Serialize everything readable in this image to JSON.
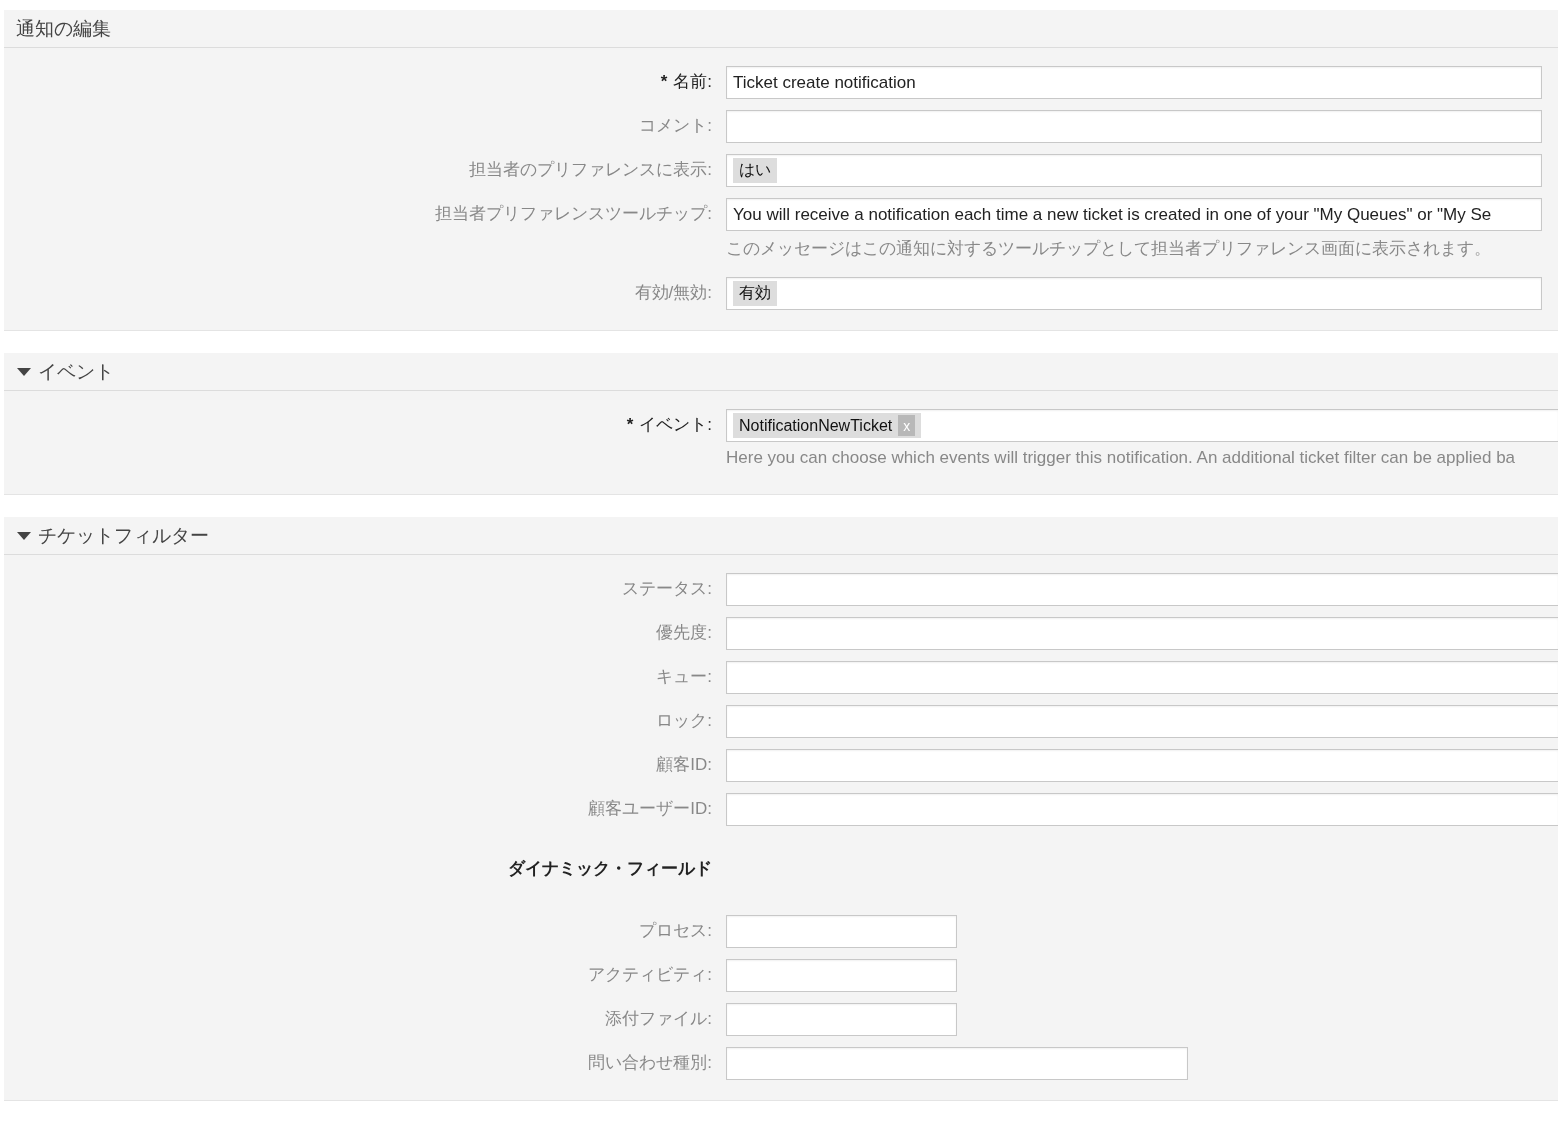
{
  "required_mark": "*",
  "sections": [
    {
      "title": "通知の編集",
      "fields": [
        {
          "kind": "text",
          "label": "名前:",
          "required": true,
          "value": "Ticket create notification"
        },
        {
          "kind": "text",
          "label": "コメント:",
          "required": false
        },
        {
          "kind": "select",
          "label": "担当者のプリファレンスに表示:",
          "required": false,
          "tags": [
            "はい"
          ]
        },
        {
          "kind": "text",
          "label": "担当者プリファレンスツールチップ:",
          "required": false,
          "value": "You will receive a notification each time a new ticket is created in one of your \"My Queues\" or \"My Se",
          "help": "このメッセージはこの通知に対するツールチップとして担当者プリファレンス画面に表示されます。"
        },
        {
          "kind": "select",
          "label": "有効/無効:",
          "required": false,
          "tags": [
            "有効"
          ]
        }
      ]
    },
    {
      "title": "イベント",
      "expanded": true,
      "fields": [
        {
          "kind": "multiselect",
          "label": "イベント:",
          "required": true,
          "tags": [
            "NotificationNewTicket"
          ],
          "remove": "x",
          "help": "Here you can choose which events will trigger this notification. An additional ticket filter can be applied ba"
        }
      ]
    },
    {
      "title": "チケットフィルター",
      "expanded": true,
      "fields": [
        {
          "kind": "select",
          "label": "ステータス:",
          "required": false
        },
        {
          "kind": "select",
          "label": "優先度:",
          "required": false
        },
        {
          "kind": "select",
          "label": "キュー:",
          "required": false
        },
        {
          "kind": "select",
          "label": "ロック:",
          "required": false
        },
        {
          "kind": "text",
          "label": "顧客ID:",
          "required": false
        },
        {
          "kind": "text",
          "label": "顧客ユーザーID:",
          "required": false
        },
        {
          "kind": "heading",
          "label": "ダイナミック・フィールド"
        },
        {
          "kind": "short",
          "label": "プロセス:",
          "required": false
        },
        {
          "kind": "short",
          "label": "アクティビティ:",
          "required": false
        },
        {
          "kind": "short",
          "label": "添付ファイル:",
          "required": false
        },
        {
          "kind": "medium",
          "label": "問い合わせ種別:",
          "required": false
        }
      ]
    }
  ]
}
